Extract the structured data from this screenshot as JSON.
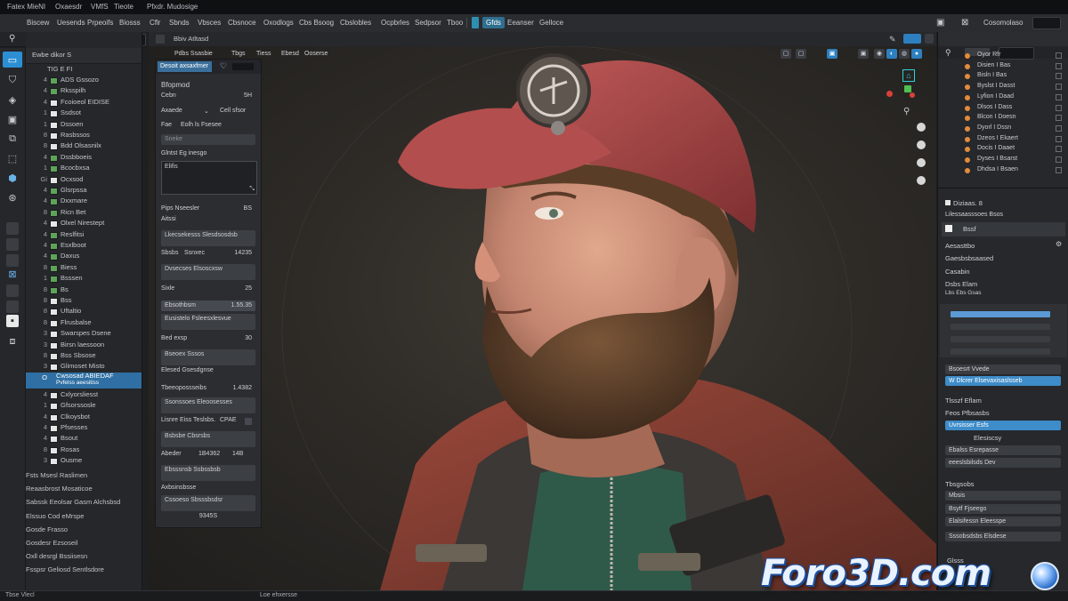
{
  "titlebar": {
    "items": [
      "Fatex MieNI",
      "Oxaesdr",
      "VMfS",
      "Tieote",
      "Pfxdr. Mudosige"
    ]
  },
  "menubar": {
    "items": [
      "Biscew",
      "Uesends",
      "Prpeoifs",
      "Biosss",
      "Cflr",
      "Sbnds",
      "Vbsces",
      "Cbsnoce",
      "Oxodlogs",
      "Cbs Bsoog",
      "Cbslobles",
      "Ocpbrles",
      "Sedpsor",
      "Tboo"
    ],
    "active_item": "Gfds",
    "extra_item": "Eeanser",
    "extra_item2": "Gelloce",
    "right_label": "Cosomolaso"
  },
  "outliner": {
    "header": "Ewbe dikor S",
    "top_label": "TIG E FI",
    "rows": [
      {
        "num": "4",
        "label": "ADS Gssozo",
        "color": "#5fa35a"
      },
      {
        "num": "4",
        "label": "Rksspilh",
        "color": "#5fa35a"
      },
      {
        "num": "4",
        "label": "Fcoioeol EIDISE",
        "color": "#e6e6e6"
      },
      {
        "num": "1",
        "label": "Ssdsot",
        "color": "#e6e6e6"
      },
      {
        "num": "1",
        "label": "Dssoen",
        "color": "#e6e6e6"
      },
      {
        "num": "8",
        "label": "Rasbssos",
        "color": "#e6e6e6"
      },
      {
        "num": "8",
        "label": "Bdd Olsasnilx",
        "color": "#e6e6e6"
      },
      {
        "num": "4",
        "label": "Dssbboeis",
        "color": "#5fa35a"
      },
      {
        "num": "1",
        "label": "Bcocbxsa",
        "color": "#5fa35a"
      },
      {
        "num": "Gi",
        "label": "Ocxsod",
        "color": "#e6e6e6"
      },
      {
        "num": "4",
        "label": "Glsrpssa",
        "color": "#5fa35a"
      },
      {
        "num": "4",
        "label": "Dxxmare",
        "color": "#5fa35a"
      },
      {
        "num": "8",
        "label": "Ricn Bet",
        "color": "#5fa35a"
      },
      {
        "num": "4",
        "label": "Olxel Nirestept",
        "color": "#e6e6e6"
      },
      {
        "num": "4",
        "label": "Reslfitsi",
        "color": "#5fa35a"
      },
      {
        "num": "4",
        "label": "Esxlboot",
        "color": "#5fa35a"
      },
      {
        "num": "4",
        "label": "Daxus",
        "color": "#5fa35a"
      },
      {
        "num": "8",
        "label": "Biess",
        "color": "#5fa35a"
      },
      {
        "num": "1",
        "label": "Bsssen",
        "color": "#5fa35a"
      },
      {
        "num": "8",
        "label": "Bs",
        "color": "#5fa35a"
      },
      {
        "num": "8",
        "label": "Bss",
        "color": "#e6e6e6"
      },
      {
        "num": "8",
        "label": "Uftaltio",
        "color": "#e6e6e6"
      },
      {
        "num": "8",
        "label": "Flrusbalse",
        "color": "#e6e6e6"
      },
      {
        "num": "3",
        "label": "Swarspes Dsene",
        "color": "#e6e6e6"
      },
      {
        "num": "3",
        "label": "Birsn laessoon",
        "color": "#e6e6e6"
      },
      {
        "num": "8",
        "label": "Bss Sbsose",
        "color": "#e6e6e6"
      },
      {
        "num": "3",
        "label": "Glimoset Misto",
        "color": "#e6e6e6"
      }
    ],
    "selected_row": {
      "num": "O",
      "label": "Cwsosad ABIEDAF",
      "sublabel": "Pvfelss aeesitiss"
    },
    "rows_after": [
      {
        "num": "4",
        "label": "Cxlyorsliesst",
        "color": "#e6e6e6"
      },
      {
        "num": "1",
        "label": "Gfsorssosle",
        "color": "#e6e6e6"
      },
      {
        "num": "4",
        "label": "Clkoysbot",
        "color": "#e6e6e6"
      },
      {
        "num": "4",
        "label": "Pfsesses",
        "color": "#e6e6e6"
      },
      {
        "num": "4",
        "label": "Bsout",
        "color": "#e6e6e6"
      },
      {
        "num": "8",
        "label": "Rosas",
        "color": "#e6e6e6"
      },
      {
        "num": "3",
        "label": "Ousme",
        "color": "#e6e6e6"
      }
    ],
    "notes": [
      "Fsts Msesl Raslimen",
      "Reaasbrost Mosaticoe",
      "Sabssk Eeolsar Gasm Alchsbsd",
      "Elssuo Cod eMrspe",
      "Gosde Frasso",
      "Gosdesr Ezsoseil",
      "Oxll  desrgl Bssiisesn",
      "Fsspsr Geliosd Sentlsdore"
    ]
  },
  "toolbar_left": {
    "tools": [
      "select-icon",
      "cursor-icon",
      "move-icon",
      "rotate-icon",
      "scale-icon",
      "transform-icon",
      "annotate-icon",
      "measure-icon",
      "cube-icon",
      "sphere-icon",
      "grid-icon",
      "layers-icon",
      "camera-icon",
      "light-icon"
    ]
  },
  "viewport_tabs": {
    "tabs": [
      "Bbiv Atltasd"
    ]
  },
  "viewport_toolbar": {
    "buttons": [
      "Pdbs Ssasbie",
      "Tbgs",
      "Tiess",
      "Ebesd",
      "Ooserse"
    ]
  },
  "properties": {
    "tab": "Desoit axsaxfmer",
    "title": "Bfopmod",
    "r1_left": "Cebn",
    "r1_right": "5H",
    "mode_label": "Axaede",
    "mode_value": "Cell sfsor",
    "seg1": "Fae",
    "seg2": "Eolh ls Fsesee",
    "field_blank": "Sneke",
    "section1": "Glntst Eg inesgo",
    "textarea_label": "Elifis",
    "pose_label": "Pips Nseesler",
    "pose_value": "BS",
    "sub1": "Aitssi",
    "f1": "Lkecsekesss Slesdsosdsb",
    "f2_label": "Sbsbs",
    "f2_mid": "Ssnxec",
    "f2_right": "14235",
    "f3": "Dvsecses Elsoscxsw",
    "f4_label": "Sixle",
    "f4_right": "25",
    "f5_label": "Ebsothbsm",
    "f5_right": "1.55.35",
    "f6": "Eusistelo Fsleesxlesvue",
    "f7_label": "Bed exsp",
    "f7_right": "30",
    "f8": "Bseoex Sssos",
    "f9": "Elesed Gsesdgnse",
    "f10_label": "Tbeeopossseibs",
    "f10_right": "1.4382",
    "f11": "Ssonssoes Eleoosesses",
    "f12_label": "Lisnre Eiss Teslsbs.",
    "f12_right": "CPAE",
    "f13": "Bsbsbe Cbsrsbs",
    "f14_label": "Abeder",
    "f14_mid": "1B4362",
    "f14_right": "14B",
    "f15": "Ebsssnsb Ssbssbsb",
    "f16": "Axbsinsbsse",
    "f17": "Cssoeso Sbsssbsdsr",
    "bottom": "9345S"
  },
  "outliner_right": {
    "lines": [
      "Oyor Rfr",
      "Disien I Bas",
      "Bisln I Bas",
      "Byslst I Dasst",
      "Lyfion I Daad",
      "Dlsos I Dass",
      "Blcon I Doesn",
      "Dyorl I Dssn",
      "Dzeos I Ekaert",
      "Docis I Daaet",
      "Dyses I Bsarst",
      "Dhdsa I Bsaen"
    ]
  },
  "rprops": {
    "header": "Diziaas. 8",
    "sub": "Lilessaasssoes Bsos",
    "chip": "Bssf",
    "l1": "Aesasttbo",
    "l2": "Gaesbsbsaased",
    "l3": "Casabin",
    "l4": "Dsbs Elam",
    "l5": "Lbs Ebs Gsas",
    "sect1": "Bsoesrt Vvede",
    "sel1": "W Dlcrer Elsevaxisaslsseb",
    "sect2": "Tlsszf Eflam",
    "l6": "Feos Pfbsasbs",
    "sel2": "Uvrsisser Esfs",
    "f1": "Elesiscsy",
    "f2": "Ebalss Esrepasse",
    "f3": "eeeslsbilsds Dev",
    "sect3": "Tbsgsobs",
    "f4": "Mbsis",
    "f5": "Bsytf Fjseego",
    "f6": "Elalsifessn Eleesspe",
    "f7": "Sssobsdsbs Elsdese",
    "sect4": "Glsss"
  },
  "statusbar": {
    "left": "Tbse Vlecl",
    "mid": "Loe ehxersse"
  },
  "watermark": {
    "text": "Foro3D.com"
  },
  "colors": {
    "accent": "#2c8fd4",
    "selection": "#2f6fa3",
    "panel": "#26282c",
    "swatch_green": "#5fa35a",
    "dot_orange": "#e38b3c"
  }
}
